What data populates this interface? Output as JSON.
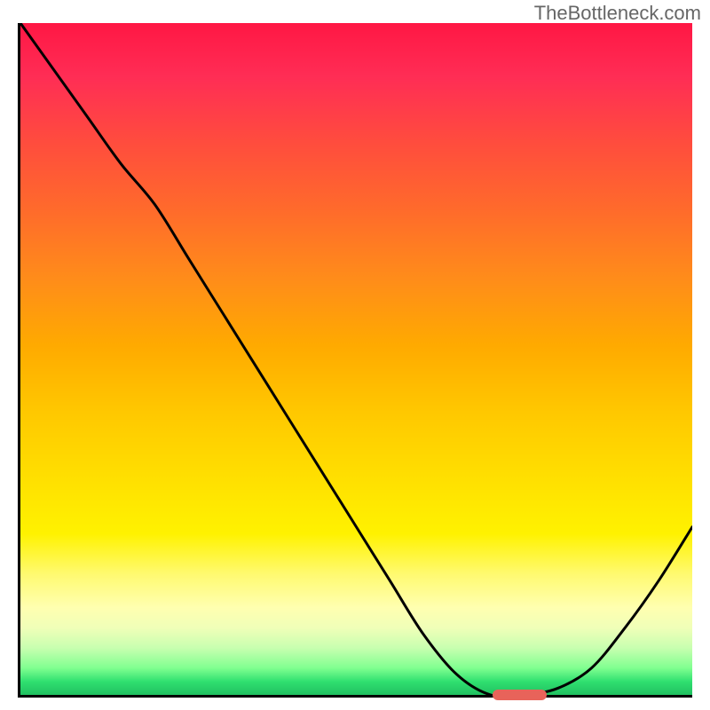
{
  "watermark": "TheBottleneck.com",
  "chart_data": {
    "type": "line",
    "title": "",
    "xlabel": "",
    "ylabel": "",
    "xlim": [
      0,
      100
    ],
    "ylim": [
      0,
      100
    ],
    "grid": false,
    "series": [
      {
        "name": "bottleneck-curve",
        "x": [
          0,
          5,
          10,
          15,
          20,
          25,
          30,
          35,
          40,
          45,
          50,
          55,
          60,
          65,
          70,
          75,
          80,
          85,
          90,
          95,
          100
        ],
        "y": [
          100,
          93,
          86,
          79,
          73,
          65,
          57,
          49,
          41,
          33,
          25,
          17,
          9,
          3,
          0,
          0,
          1,
          4,
          10,
          17,
          25
        ]
      }
    ],
    "annotations": [
      {
        "name": "optimal-marker",
        "x_start": 70,
        "x_end": 78,
        "y": 0,
        "color": "#e8635a"
      }
    ],
    "background": {
      "type": "vertical-gradient",
      "stops": [
        {
          "pos": 0.0,
          "color": "#ff1744"
        },
        {
          "pos": 0.5,
          "color": "#ffc800"
        },
        {
          "pos": 0.85,
          "color": "#ffffb0"
        },
        {
          "pos": 1.0,
          "color": "#20c060"
        }
      ]
    }
  }
}
